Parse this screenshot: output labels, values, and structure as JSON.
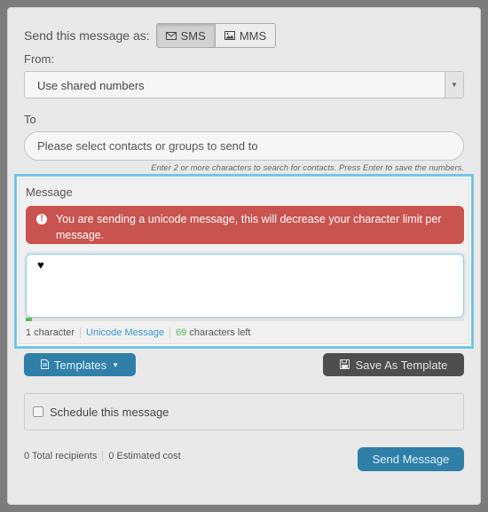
{
  "send_as": {
    "label": "Send this message as:",
    "options": [
      {
        "label": "SMS",
        "icon": "envelope-icon",
        "active": true
      },
      {
        "label": "MMS",
        "icon": "image-icon",
        "active": false
      }
    ]
  },
  "from": {
    "label": "From:",
    "selected": "Use shared numbers"
  },
  "to": {
    "label": "To",
    "placeholder": "Please select contacts or groups to send to",
    "help": "Enter 2 or more characters to search for contacts. Press Enter to save the numbers."
  },
  "message": {
    "label": "Message",
    "alert": "You are sending a unicode message, this will decrease your character limit per message.",
    "content": "♥",
    "progress_percent": 1.4,
    "char_count": "1 character",
    "encoding": "Unicode Message",
    "chars_left_num": "69",
    "chars_left_text": " characters left"
  },
  "actions": {
    "templates": "Templates",
    "save_template": "Save As Template"
  },
  "schedule": {
    "label": "Schedule this message",
    "checked": false
  },
  "summary": {
    "recipients": "0 Total recipients",
    "cost": "0 Estimated cost"
  },
  "send_button": "Send Message",
  "colors": {
    "alert": "#c9534f",
    "primary": "#2f7fa9",
    "focus_border": "#74c5e8",
    "success": "#5cb85c"
  }
}
